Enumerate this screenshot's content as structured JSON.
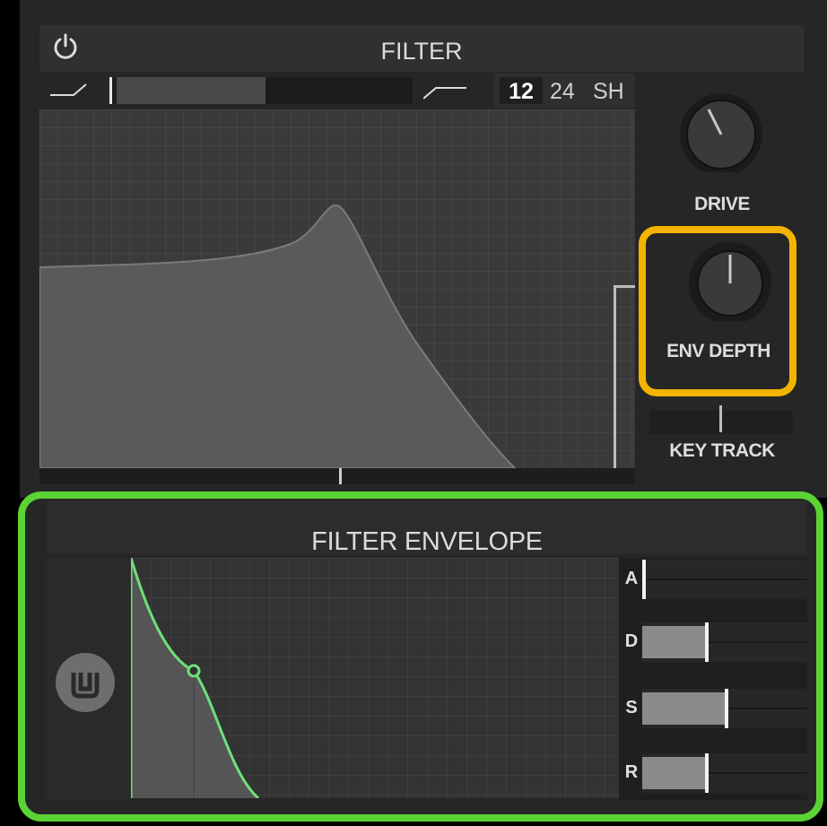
{
  "filter": {
    "title": "FILTER",
    "power_icon": "power-icon",
    "lowpass_icon": "lowpass-shape-icon",
    "highpass_icon": "highpass-shape-icon",
    "filter_morph": 0.5,
    "slopes": [
      "12",
      "24",
      "SH"
    ],
    "selected_slope": "12",
    "drive": {
      "label": "DRIVE",
      "value": -0.4
    },
    "env_depth": {
      "label": "ENV DEPTH",
      "value": 0.0
    },
    "key_track": {
      "label": "KEY TRACK",
      "value": 0.5
    }
  },
  "envelope": {
    "title": "FILTER ENVELOPE",
    "loop_icon": "envelope-loop-icon",
    "adsr": [
      {
        "label": "A",
        "value": 0.0
      },
      {
        "label": "D",
        "value": 0.38
      },
      {
        "label": "S",
        "value": 0.5
      },
      {
        "label": "R",
        "value": 0.38
      }
    ]
  },
  "colors": {
    "env_panel_highlight": "#5ad334",
    "env_depth_highlight": "#f2b400",
    "envelope_curve": "#6ee07a",
    "panel_bg": "#262626"
  }
}
